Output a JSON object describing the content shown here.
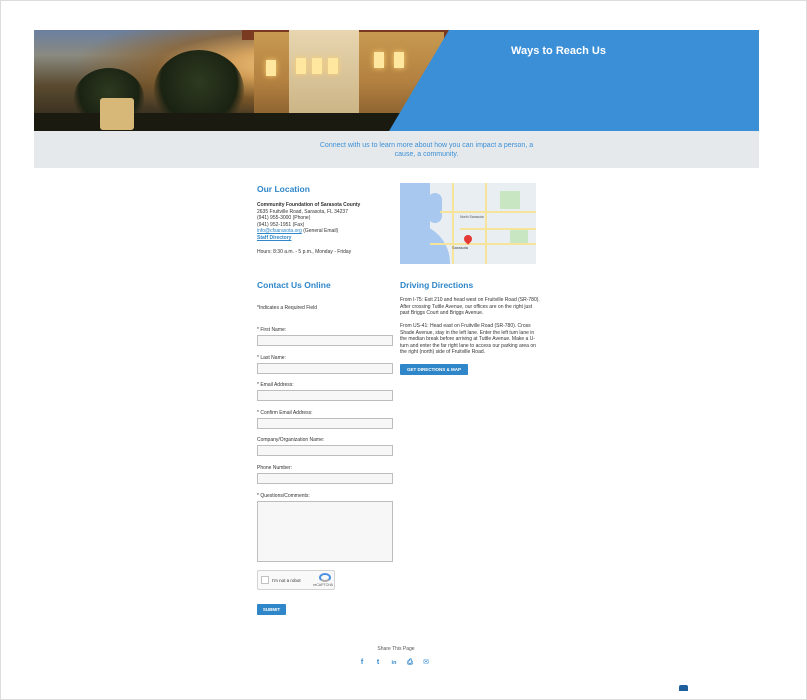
{
  "hero": {
    "title": "Ways to Reach Us"
  },
  "band": {
    "tagline": "Connect with us to learn more about how you can impact a person, a cause, a community."
  },
  "location": {
    "heading": "Our Location",
    "org": "Community Foundation of Sarasota County",
    "address": "2635 Fruitville Road, Sarasota, FL 34237",
    "phone": "(941) 955-3000 (Phone)",
    "fax": "(941) 952-1951 (Fax)",
    "email_link": "info@cfsarasota.org",
    "email_suffix": " (General Email)",
    "staff_link": "Staff Directory",
    "hours": "Hours: 8:30 a.m. - 5 p.m., Monday - Friday"
  },
  "form": {
    "heading": "Contact Us Online",
    "required_note": "*Indicates a Required Field",
    "fields": [
      {
        "label": "* First Name:"
      },
      {
        "label": "* Last Name:"
      },
      {
        "label": "* Email Address:"
      },
      {
        "label": "* Confirm Email Address:"
      },
      {
        "label": "Company/Organization Name:"
      },
      {
        "label": "Phone Number:"
      },
      {
        "label": "* Questions/Comments:"
      }
    ],
    "captcha_text": "I'm not a robot",
    "captcha_brand": "reCAPTCHA",
    "submit_label": "SUBMIT"
  },
  "directions": {
    "heading": "Driving Directions",
    "p1": "From I-75: Exit 210 and head west on Fruitville Road (SR-780). After crossing Tuttle Avenue, our offices are on the right just past Briggs Court and Briggs Avenue.",
    "p2": "From US-41: Head east on Fruitville Road (SR-780). Cross Shade Avenue, stay in the left lane. Enter the left turn lane in the median break before arriving at Tuttle Avenue. Make a U-turn and enter the far right lane to access our parking area on the right (north) side of Fruitville Road.",
    "button_label": "GET DIRECTIONS & MAP"
  },
  "map": {
    "labels": [
      "Sarasota",
      "North Sarasota"
    ]
  },
  "share": {
    "label": "Share This Page",
    "icons": [
      "facebook-icon",
      "twitter-icon",
      "linkedin-icon",
      "print-icon",
      "email-icon"
    ],
    "glyphs": [
      "f",
      "t",
      "in",
      "⎙",
      "✉"
    ]
  },
  "colors": {
    "accent": "#2f86c8",
    "hero_blue": "#3a8fd6",
    "band": "#e6e9ec"
  }
}
